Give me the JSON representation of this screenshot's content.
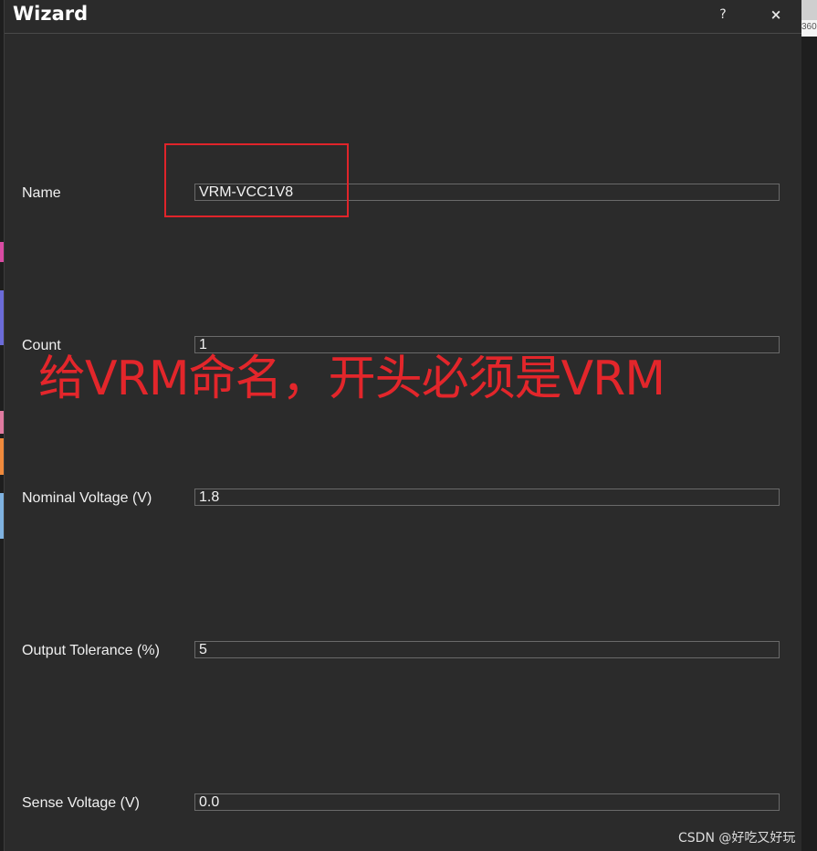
{
  "window": {
    "title": "Wizard",
    "help_label": "?",
    "close_label": "×"
  },
  "fields": [
    {
      "label": "Name",
      "value": "VRM-VCC1V8"
    },
    {
      "label": "Count",
      "value": "1"
    },
    {
      "label": "Nominal Voltage (V)",
      "value": "1.8"
    },
    {
      "label": "Output Tolerance (%)",
      "value": "5"
    },
    {
      "label": "Sense Voltage (V)",
      "value": "0.0"
    }
  ],
  "annotation": {
    "text": "给VRM命名，开头必须是VRM",
    "color": "#e3262b"
  },
  "background_window": {
    "ruler_text": "360"
  },
  "watermark": "CSDN @好吃又好玩",
  "colors": {
    "dialog_bg": "#2b2b2b",
    "text": "#f0f0f0",
    "field_border": "#6a6a6a",
    "highlight_box": "#e0242a"
  }
}
